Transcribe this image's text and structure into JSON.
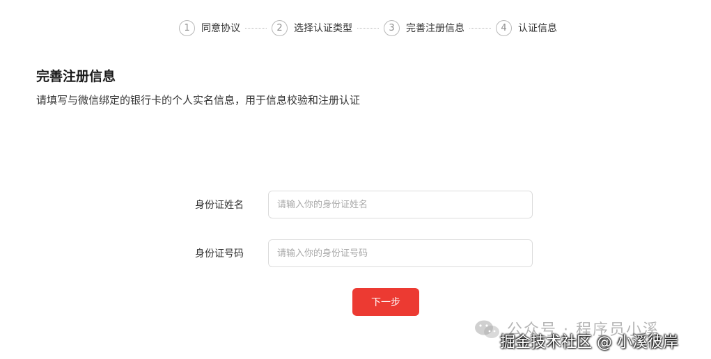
{
  "steps": [
    {
      "num": "1",
      "label": "同意协议"
    },
    {
      "num": "2",
      "label": "选择认证类型"
    },
    {
      "num": "3",
      "label": "完善注册信息"
    },
    {
      "num": "4",
      "label": "认证信息"
    }
  ],
  "page": {
    "title": "完善注册信息",
    "description": "请填写与微信绑定的银行卡的个人实名信息，用于信息校验和注册认证"
  },
  "form": {
    "name_label": "身份证姓名",
    "name_placeholder": "请输入你的身份证姓名",
    "id_label": "身份证号码",
    "id_placeholder": "请输入你的身份证号码",
    "next_label": "下一步"
  },
  "watermark": {
    "line1": "公众号 · 程序员小溪",
    "line2": "掘金技术社区 @ 小溪彼岸"
  },
  "colors": {
    "primary": "#ec3a32",
    "border": "#dcdcdc",
    "step_circle": "#b8b8b8"
  }
}
